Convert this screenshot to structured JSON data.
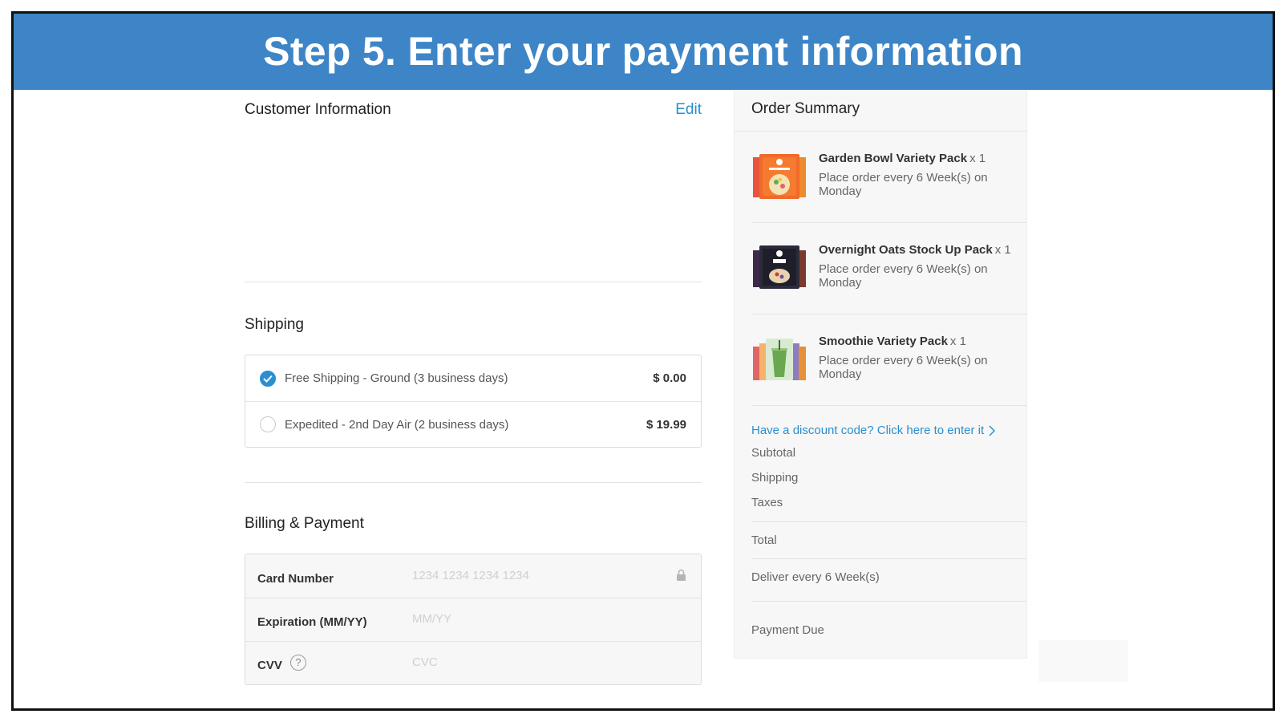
{
  "banner": {
    "title": "Step 5. Enter your payment information"
  },
  "customer": {
    "title": "Customer Information",
    "edit_label": "Edit"
  },
  "shipping": {
    "title": "Shipping",
    "options": [
      {
        "label": "Free Shipping - Ground (3 business days)",
        "price": "$ 0.00",
        "selected": true
      },
      {
        "label": "Expedited - 2nd Day Air (2 business days)",
        "price": "$ 19.99",
        "selected": false
      }
    ]
  },
  "billing": {
    "title": "Billing & Payment",
    "card_number": {
      "label": "Card Number",
      "placeholder": "1234 1234 1234 1234"
    },
    "expiration": {
      "label": "Expiration (MM/YY)",
      "placeholder": "MM/YY"
    },
    "cvv": {
      "label": "CVV",
      "help": "?",
      "placeholder": "CVC"
    }
  },
  "order_summary": {
    "title": "Order Summary",
    "items": [
      {
        "name": "Garden Bowl Variety Pack",
        "qty": "x 1",
        "schedule": "Place order every 6 Week(s) on Monday",
        "image": "garden-bowl-pack"
      },
      {
        "name": "Overnight Oats Stock Up Pack",
        "qty": "x 1",
        "schedule": "Place order every 6 Week(s) on Monday",
        "image": "overnight-oats-pack"
      },
      {
        "name": "Smoothie Variety Pack",
        "qty": "x 1",
        "schedule": "Place order every 6 Week(s) on Monday",
        "image": "smoothie-pack"
      }
    ],
    "discount_link": "Have a discount code? Click here to enter it",
    "subtotal_label": "Subtotal",
    "shipping_label": "Shipping",
    "taxes_label": "Taxes",
    "total_label": "Total",
    "deliver_label": "Deliver every 6 Week(s)",
    "payment_due_label": "Payment Due"
  },
  "colors": {
    "banner": "#3d85c6",
    "link": "#2a8fd0"
  }
}
